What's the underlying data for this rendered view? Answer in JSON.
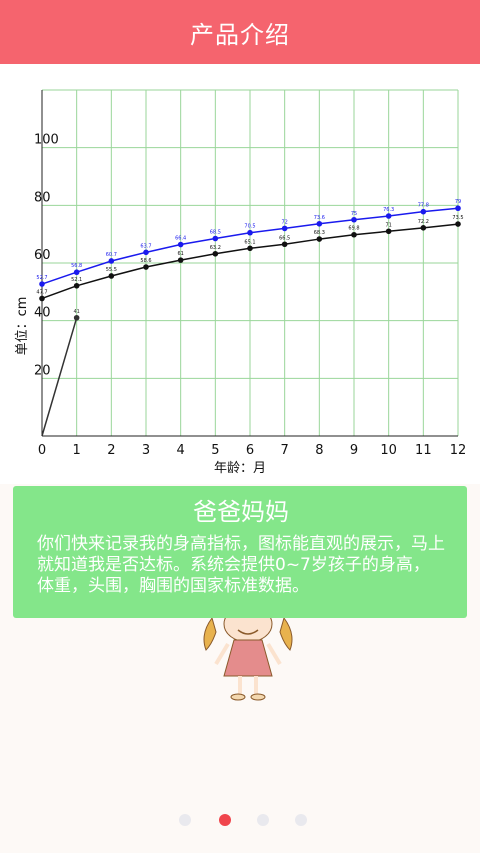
{
  "header": {
    "title": "产品介绍"
  },
  "chart_data": {
    "type": "line",
    "xlabel": "年龄：月",
    "ylabel": "单位：cm",
    "x_ticks": [
      "0",
      "1",
      "2",
      "3",
      "4",
      "5",
      "6",
      "7",
      "8",
      "9",
      "10",
      "11",
      "12"
    ],
    "y_ticks": [
      "20",
      "40",
      "60",
      "80",
      "100"
    ],
    "xlim": [
      0,
      12
    ],
    "ylim": [
      0,
      120
    ],
    "grid": true,
    "series": [
      {
        "color": "#1a1aee",
        "x": [
          0,
          1,
          2,
          3,
          4,
          5,
          6,
          7,
          8,
          9,
          10,
          11,
          12
        ],
        "values": [
          52.7,
          56.8,
          60.7,
          63.7,
          66.4,
          68.5,
          70.5,
          72,
          73.6,
          75,
          76.3,
          77.8,
          79
        ],
        "labels": [
          "52.7",
          "56.8",
          "60.7",
          "63.7",
          "66.4",
          "68.5",
          "70.5",
          "72",
          "73.6",
          "75",
          "76.3",
          "77.8",
          "79"
        ]
      },
      {
        "color": "#111111",
        "x": [
          0,
          1,
          2,
          3,
          4,
          5,
          6,
          7,
          8,
          9,
          10,
          11,
          12
        ],
        "values": [
          47.7,
          52.1,
          55.5,
          58.6,
          61,
          63.2,
          65.1,
          66.5,
          68.3,
          69.8,
          71,
          72.2,
          73.5
        ],
        "labels": [
          "47.7",
          "52.1",
          "55.5",
          "58.6",
          "61",
          "63.2",
          "65.1",
          "66.5",
          "68.3",
          "69.8",
          "71",
          "72.2",
          "73.5"
        ]
      },
      {
        "color": "#333333",
        "x": [
          0,
          1
        ],
        "values": [
          0,
          41
        ],
        "labels": [
          "",
          "41"
        ]
      }
    ]
  },
  "card": {
    "title": "爸爸妈妈",
    "body": "你们快来记录我的身高指标，图标能直观的展示，马上就知道我是否达标。系统会提供0~7岁孩子的身高，体重，头围，胸围的国家标准数据。"
  },
  "pager": {
    "count": 4,
    "active": 1,
    "active_color": "#f0454c",
    "inactive_color": "#e9e9ee"
  }
}
